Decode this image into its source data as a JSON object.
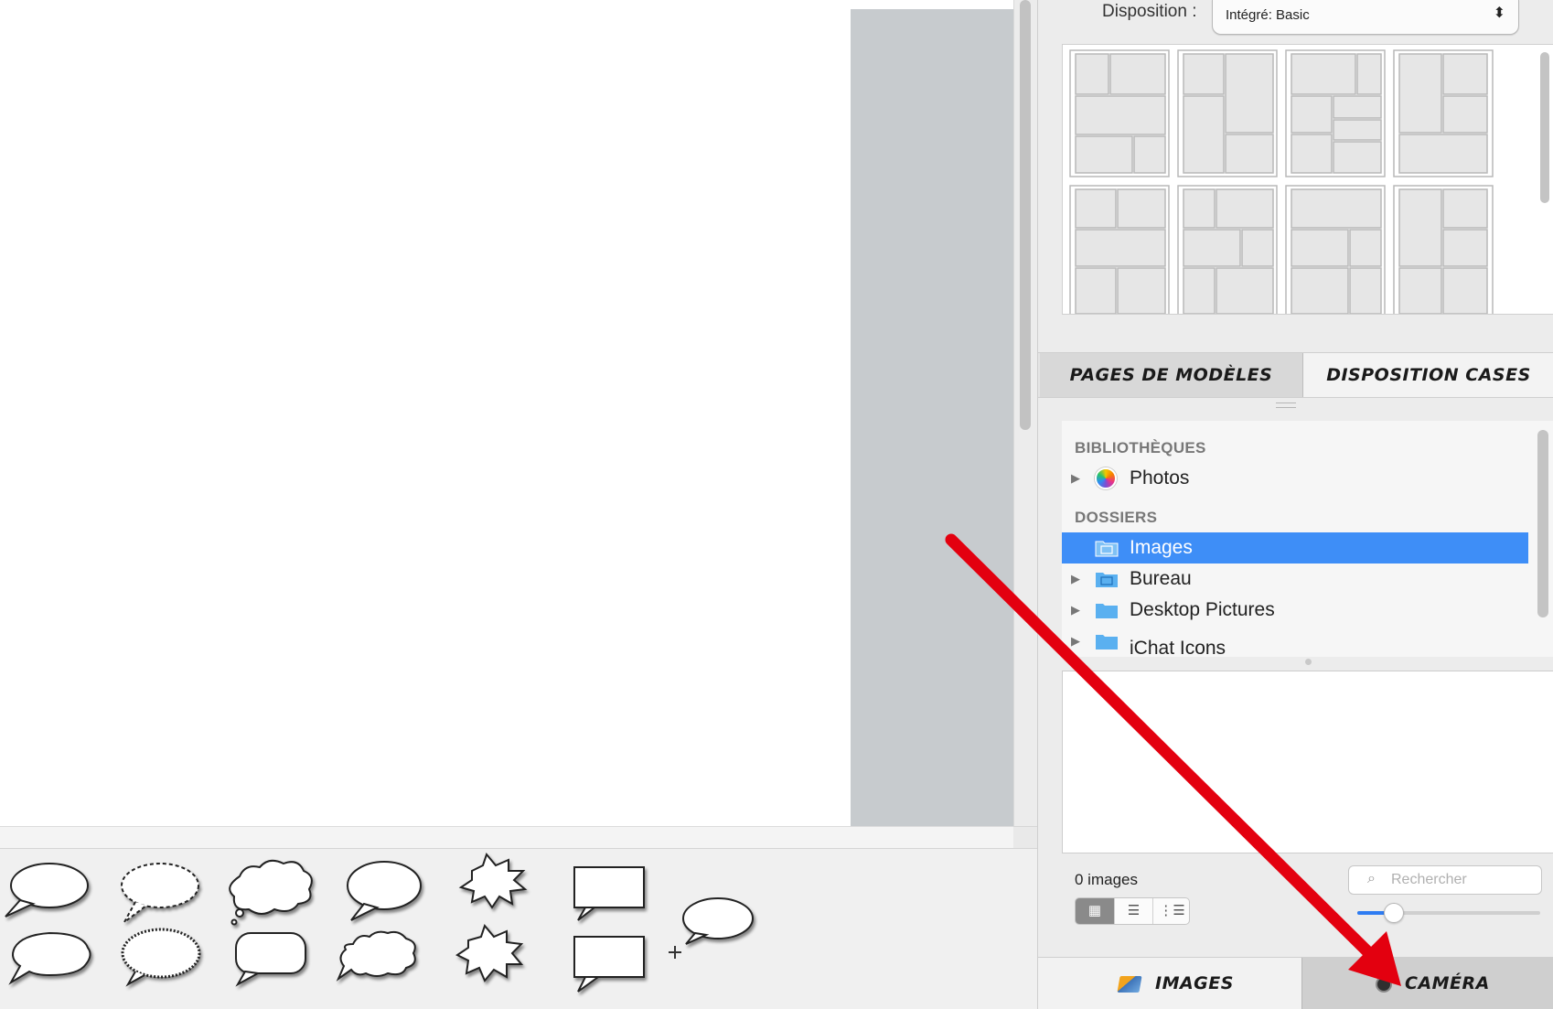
{
  "layout_panel": {
    "label": "Disposition :",
    "selected": "Intégré: Basic",
    "arrows_icon": "up-down-chevron-icon"
  },
  "tabs": {
    "templates": "PAGES DE MODÈLES",
    "panel_layout": "DISPOSITION CASES"
  },
  "source_list": {
    "libraries_header": "BIBLIOTHÈQUES",
    "folders_header": "DOSSIERS",
    "items": [
      {
        "label": "Photos",
        "icon": "photos-icon",
        "selected": false
      },
      {
        "label": "Images",
        "icon": "folder-icon",
        "selected": true
      },
      {
        "label": "Bureau",
        "icon": "folder-icon",
        "selected": false
      },
      {
        "label": "Desktop Pictures",
        "icon": "folder-icon",
        "selected": false
      },
      {
        "label": "iChat Icons",
        "icon": "folder-icon",
        "selected": false
      }
    ]
  },
  "browser": {
    "count": "0 images",
    "search_placeholder": "Rechercher",
    "zoom_level": 0.2
  },
  "bottom_tabs": {
    "images": "IMAGES",
    "camera": "CAMÉRA",
    "active": "camera"
  },
  "colors": {
    "selection": "#3e8ef7",
    "annotation_arrow": "#e3000f",
    "pasteboard": "#c7cbce"
  }
}
